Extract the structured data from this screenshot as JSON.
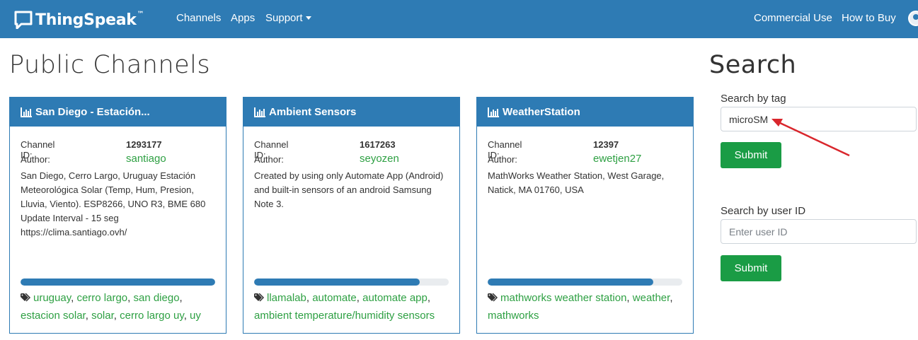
{
  "navbar": {
    "brand": "ThingSpeak",
    "trademark": "™",
    "links": [
      "Channels",
      "Apps",
      "Support"
    ],
    "right_links": [
      "Commercial Use",
      "How to Buy"
    ]
  },
  "page_title": "Public Channels",
  "channels": [
    {
      "title": "San Diego - Estación...",
      "channel_id_label": "Channel ID:",
      "channel_id": "1293177",
      "author_label": "Author:",
      "author": "santiago",
      "description": [
        "San Diego, Cerro Largo, Uruguay Estación",
        "Meteorológica Solar (Temp, Hum, Presion,",
        "Lluvia, Viento). ESP8266, UNO R3, BME 680",
        "Update Interval - 15 seg",
        "https://clima.santiago.ovh/"
      ],
      "progress": 1.0,
      "tags": [
        "uruguay",
        "cerro largo",
        "san diego",
        "estacion solar",
        "solar",
        "cerro largo uy",
        "uy"
      ]
    },
    {
      "title": "Ambient Sensors",
      "channel_id_label": "Channel ID:",
      "channel_id": "1617263",
      "author_label": "Author:",
      "author": "seyozen",
      "description": [
        "Created by using only Automate App (Android)",
        "and built-in sensors of an android Samsung",
        "Note 3."
      ],
      "progress": 0.85,
      "tags": [
        "llamalab",
        "automate",
        "automate app",
        "ambient temperature/humidity sensors"
      ]
    },
    {
      "title": "WeatherStation",
      "channel_id_label": "Channel ID:",
      "channel_id": "12397",
      "author_label": "Author:",
      "author": "ewetjen27",
      "description": [
        "MathWorks Weather Station, West Garage,",
        "Natick, MA 01760, USA"
      ],
      "progress": 0.85,
      "tags": [
        "mathworks weather station",
        "weather",
        "mathworks"
      ]
    }
  ],
  "search": {
    "title": "Search",
    "tag_label": "Search by tag",
    "tag_value": "microSM",
    "tag_submit": "Submit",
    "user_label": "Search by user ID",
    "user_placeholder": "Enter user ID",
    "user_submit": "Submit"
  },
  "colors": {
    "primary": "#2e7bb4",
    "link_green": "#2ea043",
    "button_green": "#1a9c45",
    "annotation_arrow": "#d9262c"
  }
}
